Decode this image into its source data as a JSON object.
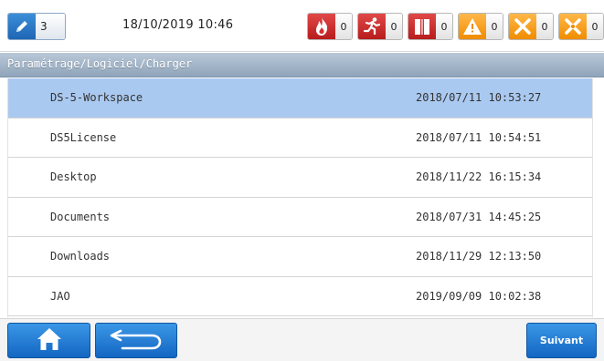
{
  "status": {
    "user_level": "3",
    "datetime": "18/10/2019 10:46",
    "alarms": [
      {
        "icon": "fire-icon",
        "count": "0",
        "color": "#c92a2a"
      },
      {
        "icon": "running-person-icon",
        "count": "0",
        "color": "#c92a2a"
      },
      {
        "icon": "fire-door-icon",
        "count": "0",
        "color": "#c92a2a"
      },
      {
        "icon": "warning-icon",
        "count": "0",
        "color": "#f5a000"
      },
      {
        "icon": "fault-cross-icon",
        "count": "0",
        "color": "#f5a000"
      },
      {
        "icon": "disabled-cross-icon",
        "count": "0",
        "color": "#f5a000"
      }
    ]
  },
  "path": "Paramétrage/Logiciel/Charger",
  "files": [
    {
      "name": "DS-5-Workspace",
      "date": "2018/07/11 10:53:27",
      "selected": true
    },
    {
      "name": "DS5License",
      "date": "2018/07/11 10:54:51",
      "selected": false
    },
    {
      "name": "Desktop",
      "date": "2018/11/22 16:15:34",
      "selected": false
    },
    {
      "name": "Documents",
      "date": "2018/07/31 14:45:25",
      "selected": false
    },
    {
      "name": "Downloads",
      "date": "2018/11/29 12:13:50",
      "selected": false
    },
    {
      "name": "JAO",
      "date": "2019/09/09 10:02:38",
      "selected": false
    }
  ],
  "footer": {
    "home_icon": "home-icon",
    "back_icon": "back-arrow-icon",
    "next_label": "Suivant"
  },
  "colors": {
    "accent": "#1e7bd6",
    "selected_row": "#aac9f0",
    "path_bar": "#9fb2c6"
  }
}
